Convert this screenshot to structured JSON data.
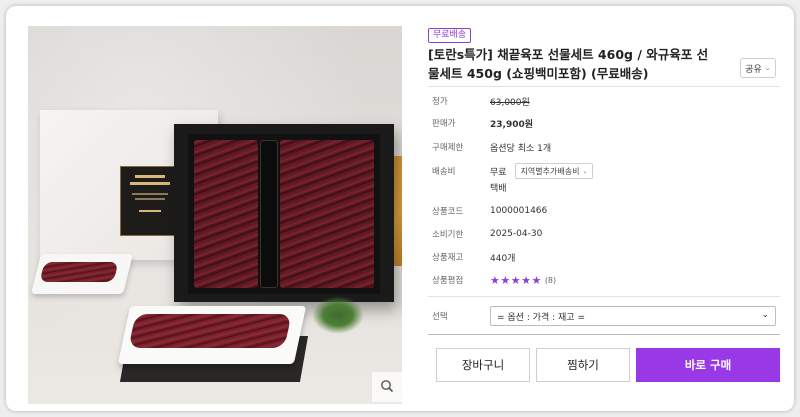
{
  "product": {
    "badge": "무료배송",
    "title": "[토란s특가] 채끝육포 선물세트 460g / 와규육포 선물세트 450g (쇼핑백미포함) (무료배송)",
    "share_label": "공유"
  },
  "details": {
    "list_price_label": "정가",
    "list_price": "63,000원",
    "sale_price_label": "판매가",
    "sale_price": "23,900원",
    "purchase_limit_label": "구매제한",
    "purchase_limit": "옵션당 최소 1개",
    "shipping_label": "배송비",
    "shipping_fee": "무료",
    "region_button": "지역별추가배송비",
    "shipping_method": "택배",
    "code_label": "상품코드",
    "code": "1000001466",
    "expiry_label": "소비기한",
    "expiry": "2025-04-30",
    "stock_label": "상품재고",
    "stock": "440개",
    "rating_label": "상품평점",
    "rating_stars": 5,
    "review_count": "(8)"
  },
  "option": {
    "label": "선택",
    "placeholder": "= 옵션 : 가격 : 재고 ="
  },
  "actions": {
    "cart": "장바구니",
    "wishlist": "찜하기",
    "buy_now": "바로 구매"
  },
  "colors": {
    "accent": "#9838e6",
    "badge": "#8f3fd6",
    "star": "#8f3fd6"
  },
  "icons": {
    "zoom": "magnifier-icon",
    "dropdown": "chevron-down-icon"
  }
}
